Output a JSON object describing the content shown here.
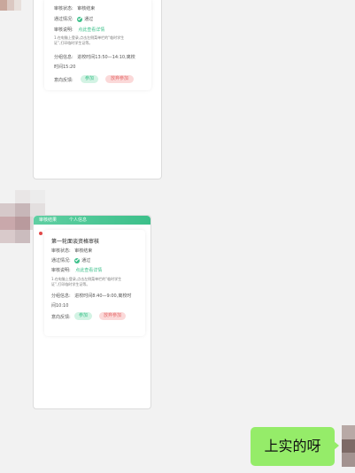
{
  "card_top": {
    "status_label": "审核状态:",
    "status_value": "审核结束",
    "pass_label": "通过情况:",
    "pass_value": "通过",
    "desc_label": "审核说明:",
    "desc_link": "点此查看详情",
    "note_line1": "1.在电脑上登录,点击左侧菜单栏的“临时学生",
    "note_line2": "证”,打印临时学生证等。",
    "group_label": "分组信息:",
    "group_value_line1": "进校时间13:50—14:10,离校",
    "group_value_line2": "时间15:20",
    "feedback_label": "意向反馈:",
    "btn_join": "参加",
    "btn_decline": "放弃参加"
  },
  "card_bottom": {
    "tab_1": "审核结果",
    "tab_2": "个人信息",
    "title": "第一轮面谈资格审核",
    "status_label": "审核状态:",
    "status_value": "审核结束",
    "pass_label": "通过情况:",
    "pass_value": "通过",
    "desc_label": "审核说明:",
    "desc_link": "点此查看详情",
    "note_line1": "1.在电脑上登录,点击左侧菜单栏的“临时学生",
    "note_line2": "证”,打印临时学生证等。",
    "group_label": "分组信息:",
    "group_value_line1": "进校时间8:40—9:00,离校时",
    "group_value_line2": "间10:10",
    "feedback_label": "意向反馈:",
    "btn_join": "参加",
    "btn_decline": "放弃参加"
  },
  "sent_message": {
    "text": "上实的呀"
  },
  "colors": {
    "accent_green": "#3cc08a",
    "bubble_green": "#95ec69",
    "pill_red": "#e56b6b"
  }
}
